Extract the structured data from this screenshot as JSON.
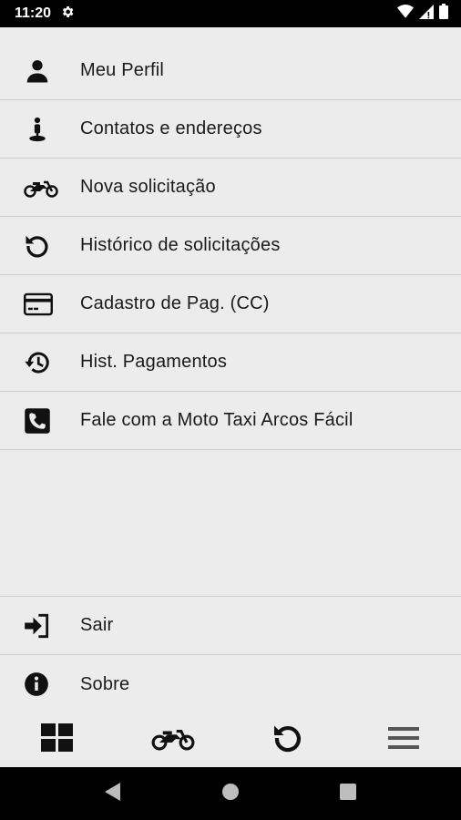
{
  "status_bar": {
    "time": "11:20",
    "icons": [
      "gear-icon",
      "wifi-icon",
      "signal-icon",
      "battery-icon"
    ]
  },
  "menu": {
    "items": [
      {
        "label": "Meu Perfil",
        "icon": "person-icon"
      },
      {
        "label": "Contatos e endereços",
        "icon": "person-pin-icon"
      },
      {
        "label": "Nova solicitação",
        "icon": "motorcycle-icon"
      },
      {
        "label": "Histórico de solicitações",
        "icon": "history-icon"
      },
      {
        "label": "Cadastro de Pag. (CC)",
        "icon": "credit-card-icon"
      },
      {
        "label": "Hist. Pagamentos",
        "icon": "restore-icon"
      },
      {
        "label": "Fale com a Moto Taxi Arcos Fácil",
        "icon": "phone-icon"
      }
    ],
    "bottom_items": [
      {
        "label": "Sair",
        "icon": "logout-icon"
      },
      {
        "label": "Sobre",
        "icon": "info-icon"
      }
    ]
  },
  "bottom_nav": {
    "icons": [
      "grid-icon",
      "motorcycle-icon",
      "history-icon",
      "menu-icon"
    ]
  },
  "system_nav": {
    "icons": [
      "back-icon",
      "home-icon",
      "recents-icon"
    ]
  },
  "colors": {
    "background": "#ececec",
    "divider": "#cfcfcf",
    "icon": "#111111",
    "status_bar": "#000000"
  }
}
